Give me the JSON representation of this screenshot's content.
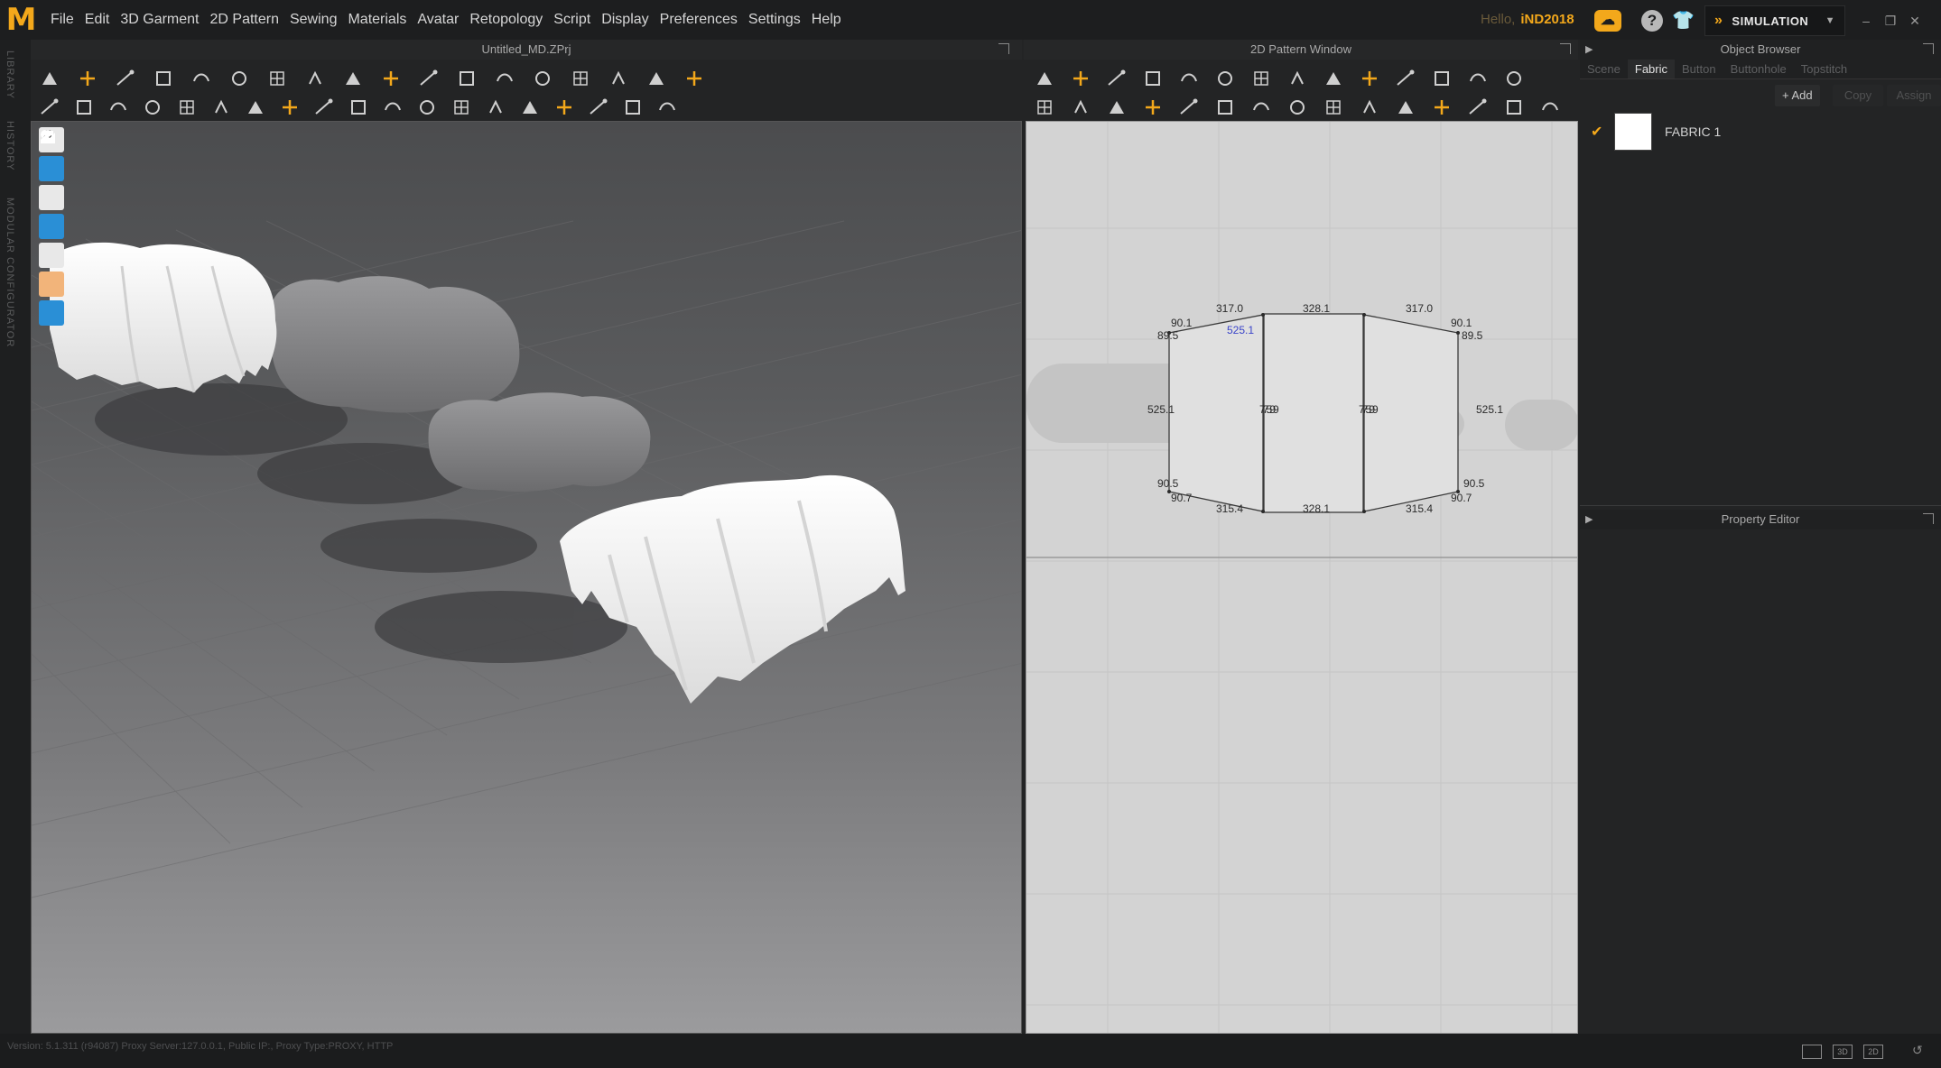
{
  "app": {
    "logo": "M",
    "hello_prefix": "Hello,",
    "user": "iND2018",
    "mode": "SIMULATION"
  },
  "menu": [
    "File",
    "Edit",
    "3D Garment",
    "2D Pattern",
    "Sewing",
    "Materials",
    "Avatar",
    "Retopology",
    "Script",
    "Display",
    "Preferences",
    "Settings",
    "Help"
  ],
  "left_tabs": [
    "LIBRARY",
    "HISTORY",
    "MODULAR CONFIGURATOR"
  ],
  "viewport3d": {
    "title": "Untitled_MD.ZPrj"
  },
  "viewport2d": {
    "title": "2D Pattern Window",
    "dims": [
      {
        "text": "317.0"
      },
      {
        "text": "328.1"
      },
      {
        "text": "317.0"
      },
      {
        "text": "90.1"
      },
      {
        "text": "89.5"
      },
      {
        "text": "525.1",
        "blue": true
      },
      {
        "text": "90.1"
      },
      {
        "text": "89.5"
      },
      {
        "text": "525.1"
      },
      {
        "text": "775.99"
      },
      {
        "text": "775.99"
      },
      {
        "text": "525.1"
      },
      {
        "text": "90.5"
      },
      {
        "text": "90.7"
      },
      {
        "text": "315.4"
      },
      {
        "text": "328.1"
      },
      {
        "text": "315.4"
      },
      {
        "text": "90.5"
      },
      {
        "text": "90.7"
      }
    ]
  },
  "object_browser": {
    "title": "Object Browser",
    "tabs": [
      "Scene",
      "Fabric",
      "Button",
      "Buttonhole",
      "Topstitch"
    ],
    "active_tab": "Fabric",
    "actions": {
      "add": "+ Add",
      "copy": "Copy",
      "assign": "Assign"
    },
    "fabrics": [
      {
        "name": "FABRIC 1",
        "checked": true,
        "color": "#ffffff"
      }
    ]
  },
  "property_editor": {
    "title": "Property Editor"
  },
  "status": {
    "text": "Version: 5.1.311 (r94087)  Proxy Server:127.0.0.1, Public IP:, Proxy Type:PROXY, HTTP"
  },
  "colors": {
    "accent": "#f3a81b",
    "tool_blue": "#2a8fd6"
  }
}
